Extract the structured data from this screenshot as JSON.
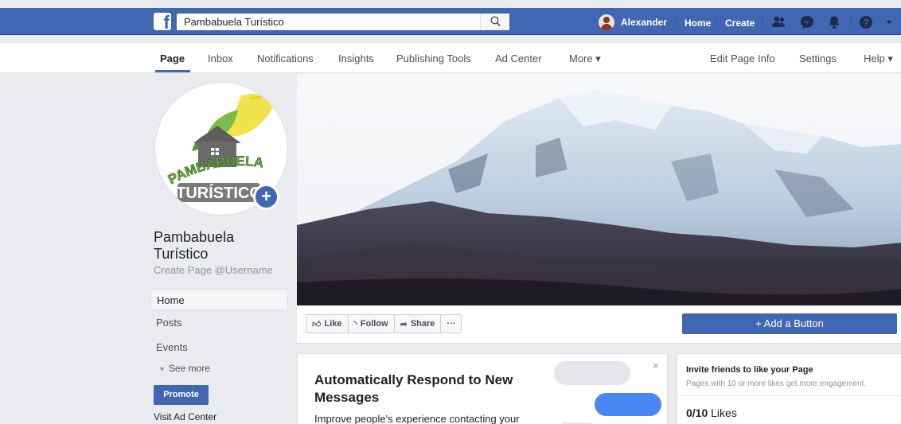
{
  "topbar": {
    "search_value": "Pambabuela Turístico",
    "user_name": "Alexander",
    "home": "Home",
    "create": "Create"
  },
  "tabs": [
    {
      "label": "Page",
      "active": true
    },
    {
      "label": "Inbox"
    },
    {
      "label": "Notifications"
    },
    {
      "label": "Insights"
    },
    {
      "label": "Publishing Tools"
    },
    {
      "label": "Ad Center"
    },
    {
      "label": "More ▾"
    },
    {
      "label": "Edit Page Info"
    },
    {
      "label": "Settings"
    },
    {
      "label": "Help ▾"
    }
  ],
  "page": {
    "name": "Pambabuela Turístico",
    "handle": "Create Page @Username",
    "logo_line1": "PAMBABUELA",
    "logo_line2": "TURÍSTICO"
  },
  "sidebar": {
    "items": [
      "Home",
      "Posts",
      "Events"
    ],
    "see_more": "See more",
    "promote": "Promote",
    "visit_ad_center": "Visit Ad Center"
  },
  "actions": {
    "like": "Like",
    "follow": "Follow",
    "share": "Share",
    "more": "···",
    "add_button": "+ Add a Button"
  },
  "respond_card": {
    "title": "Automatically Respond to New Messages",
    "body": "Improve people's experience contacting your",
    "close": "×"
  },
  "invite_card": {
    "title": "Invite friends to like your Page",
    "subtitle": "Pages with 10 or more likes get more engagement.",
    "likes_count": "0/10",
    "likes_label": "Likes"
  },
  "colors": {
    "brand_blue": "#4267b2",
    "background": "#e9ebee"
  }
}
